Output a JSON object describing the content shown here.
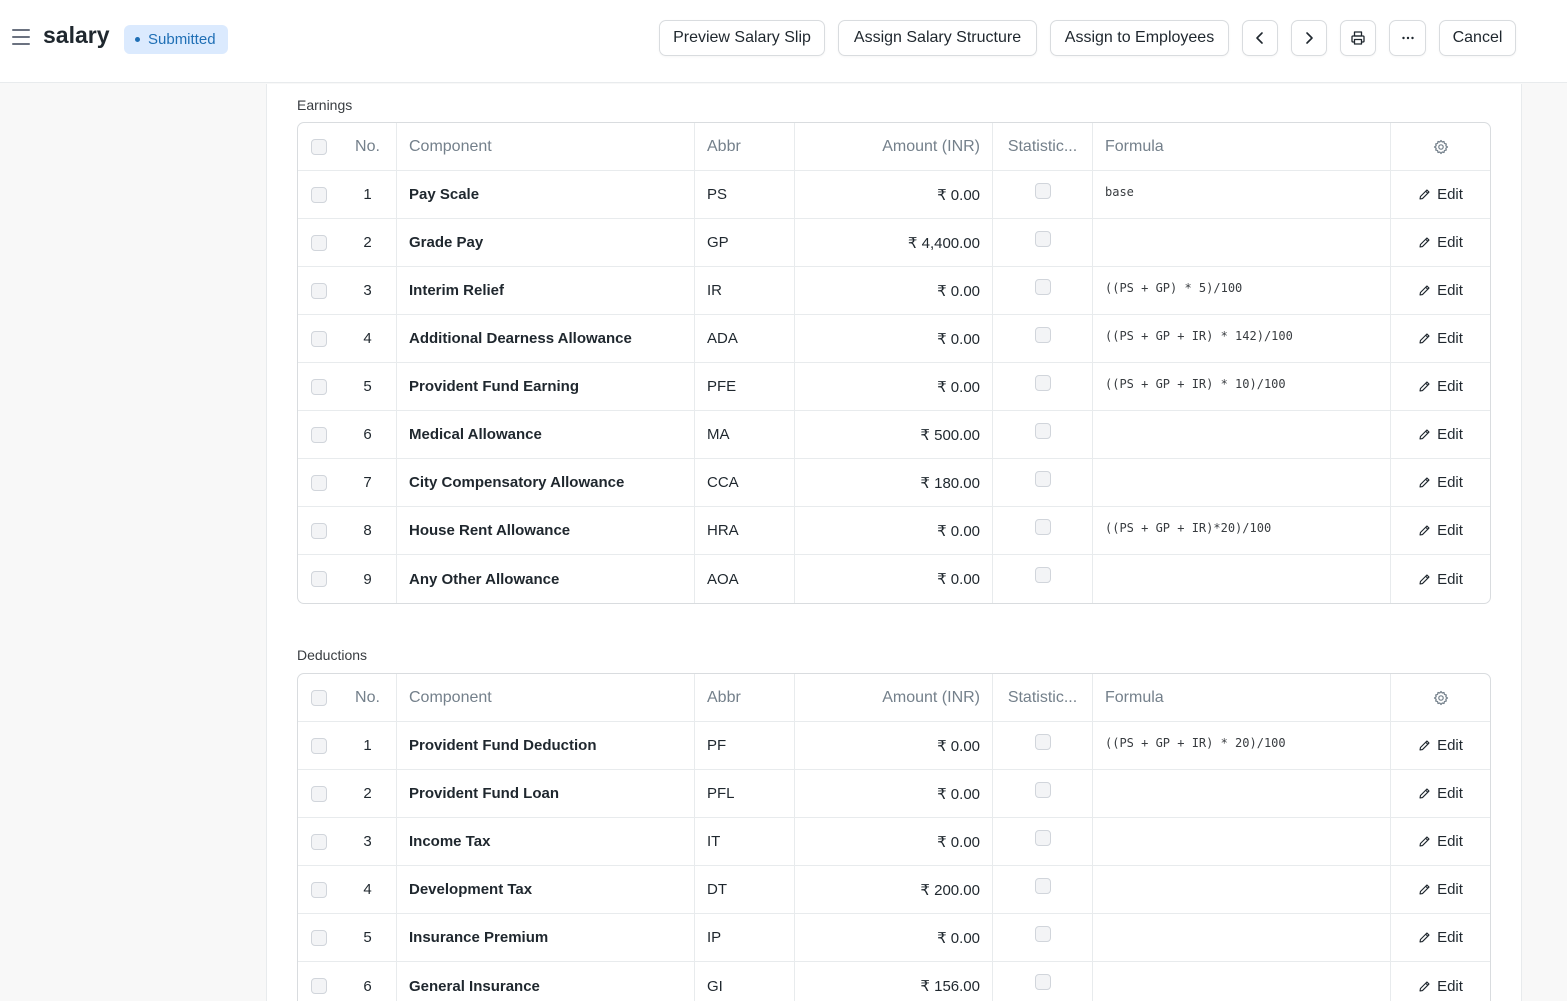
{
  "header": {
    "title": "salary",
    "status": "Submitted",
    "buttons": {
      "preview": "Preview Salary Slip",
      "assign_structure": "Assign Salary Structure",
      "assign_employees": "Assign to Employees",
      "cancel": "Cancel"
    }
  },
  "columns": {
    "no": "No.",
    "component": "Component",
    "abbr": "Abbr",
    "amount": "Amount (INR)",
    "statistical": "Statistic...",
    "formula": "Formula"
  },
  "edit_label": "Edit",
  "earnings": {
    "label": "Earnings",
    "rows": [
      {
        "no": "1",
        "component": "Pay Scale",
        "abbr": "PS",
        "amount": "₹ 0.00",
        "formula": "base"
      },
      {
        "no": "2",
        "component": "Grade Pay",
        "abbr": "GP",
        "amount": "₹ 4,400.00",
        "formula": ""
      },
      {
        "no": "3",
        "component": "Interim Relief",
        "abbr": "IR",
        "amount": "₹ 0.00",
        "formula": "((PS + GP) * 5)/100"
      },
      {
        "no": "4",
        "component": "Additional Dearness Allowance",
        "abbr": "ADA",
        "amount": "₹ 0.00",
        "formula": "((PS + GP + IR) * 142)/100"
      },
      {
        "no": "5",
        "component": "Provident Fund Earning",
        "abbr": "PFE",
        "amount": "₹ 0.00",
        "formula": "((PS + GP + IR) * 10)/100"
      },
      {
        "no": "6",
        "component": "Medical Allowance",
        "abbr": "MA",
        "amount": "₹ 500.00",
        "formula": ""
      },
      {
        "no": "7",
        "component": "City Compensatory Allowance",
        "abbr": "CCA",
        "amount": "₹ 180.00",
        "formula": ""
      },
      {
        "no": "8",
        "component": "House Rent Allowance",
        "abbr": "HRA",
        "amount": "₹ 0.00",
        "formula": "((PS + GP + IR)*20)/100"
      },
      {
        "no": "9",
        "component": "Any Other Allowance",
        "abbr": "AOA",
        "amount": "₹ 0.00",
        "formula": ""
      }
    ]
  },
  "deductions": {
    "label": "Deductions",
    "rows": [
      {
        "no": "1",
        "component": "Provident Fund Deduction",
        "abbr": "PF",
        "amount": "₹ 0.00",
        "formula": "((PS + GP + IR) * 20)/100"
      },
      {
        "no": "2",
        "component": "Provident Fund Loan",
        "abbr": "PFL",
        "amount": "₹ 0.00",
        "formula": ""
      },
      {
        "no": "3",
        "component": "Income Tax",
        "abbr": "IT",
        "amount": "₹ 0.00",
        "formula": ""
      },
      {
        "no": "4",
        "component": "Development Tax",
        "abbr": "DT",
        "amount": "₹ 200.00",
        "formula": ""
      },
      {
        "no": "5",
        "component": "Insurance Premium",
        "abbr": "IP",
        "amount": "₹ 0.00",
        "formula": ""
      },
      {
        "no": "6",
        "component": "General Insurance",
        "abbr": "GI",
        "amount": "₹ 156.00",
        "formula": ""
      }
    ]
  }
}
